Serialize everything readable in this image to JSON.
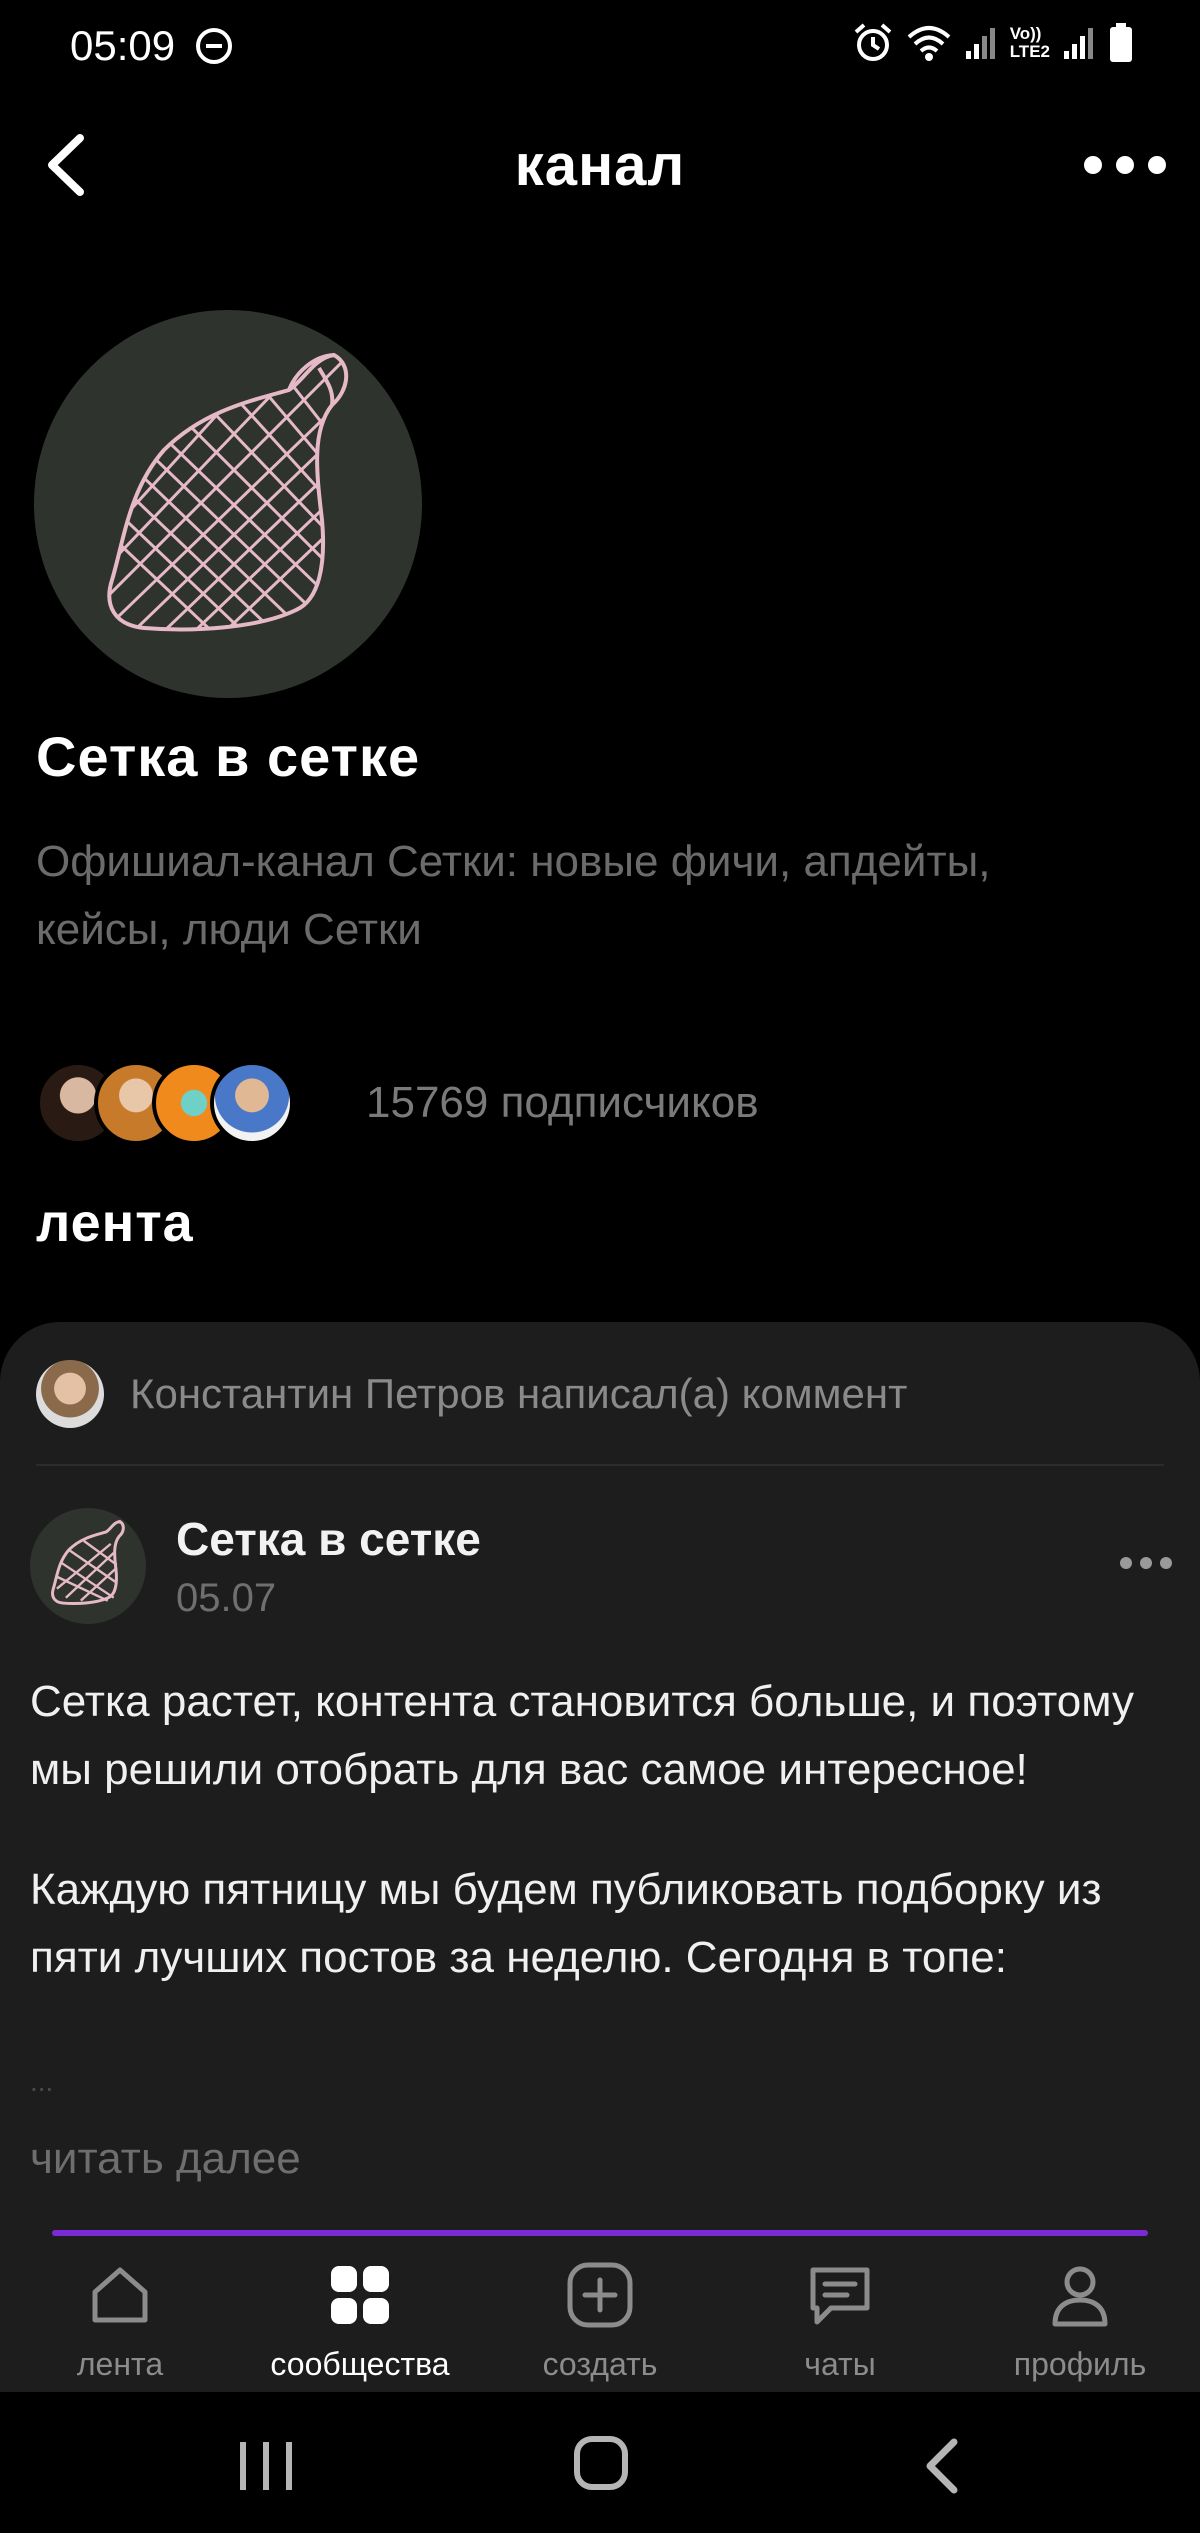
{
  "status_bar": {
    "time": "05:09",
    "network_label_top": "Vo))",
    "network_label_bottom": "LTE2",
    "icons": [
      "do-not-disturb-icon",
      "alarm-icon",
      "wifi-icon",
      "signal-icon",
      "battery-icon"
    ]
  },
  "header": {
    "title": "канал",
    "back_icon": "chevron-left-icon",
    "more_icon": "more-horizontal-icon"
  },
  "channel": {
    "name": "Сетка в сетке",
    "description": "Офишиал-канал Сетки: новые фичи, апдейты, кейсы, люди Сетки",
    "subscribers_text": "15769 подписчиков",
    "avatar_icon": "string-bag-logo"
  },
  "feed": {
    "heading": "лента",
    "comment_notice": "Константин Петров написал(а) коммент",
    "post": {
      "author": "Сетка в сетке",
      "date": "05.07",
      "paragraphs": [
        "Сетка растет, контента становится больше, и поэтому мы решили отобрать для вас самое интересное!",
        "Каждую пятницу мы будем публиковать подборку из пяти лучших постов за неделю. Сегодня в топе:"
      ],
      "truncation": "...",
      "read_more": "читать далее"
    }
  },
  "bottom_nav": {
    "items": [
      {
        "label": "лента",
        "icon": "home-icon",
        "active": false
      },
      {
        "label": "сообщества",
        "icon": "grid-icon",
        "active": true
      },
      {
        "label": "создать",
        "icon": "plus-square-icon",
        "active": false
      },
      {
        "label": "чаты",
        "icon": "chat-icon",
        "active": false
      },
      {
        "label": "профиль",
        "icon": "user-icon",
        "active": false
      }
    ]
  },
  "colors": {
    "background": "#000000",
    "card": "#1d1d1d",
    "accent": "#7a2bd6",
    "net_pink": "#e6b9c8",
    "avatar_bg": "#2e332d"
  }
}
